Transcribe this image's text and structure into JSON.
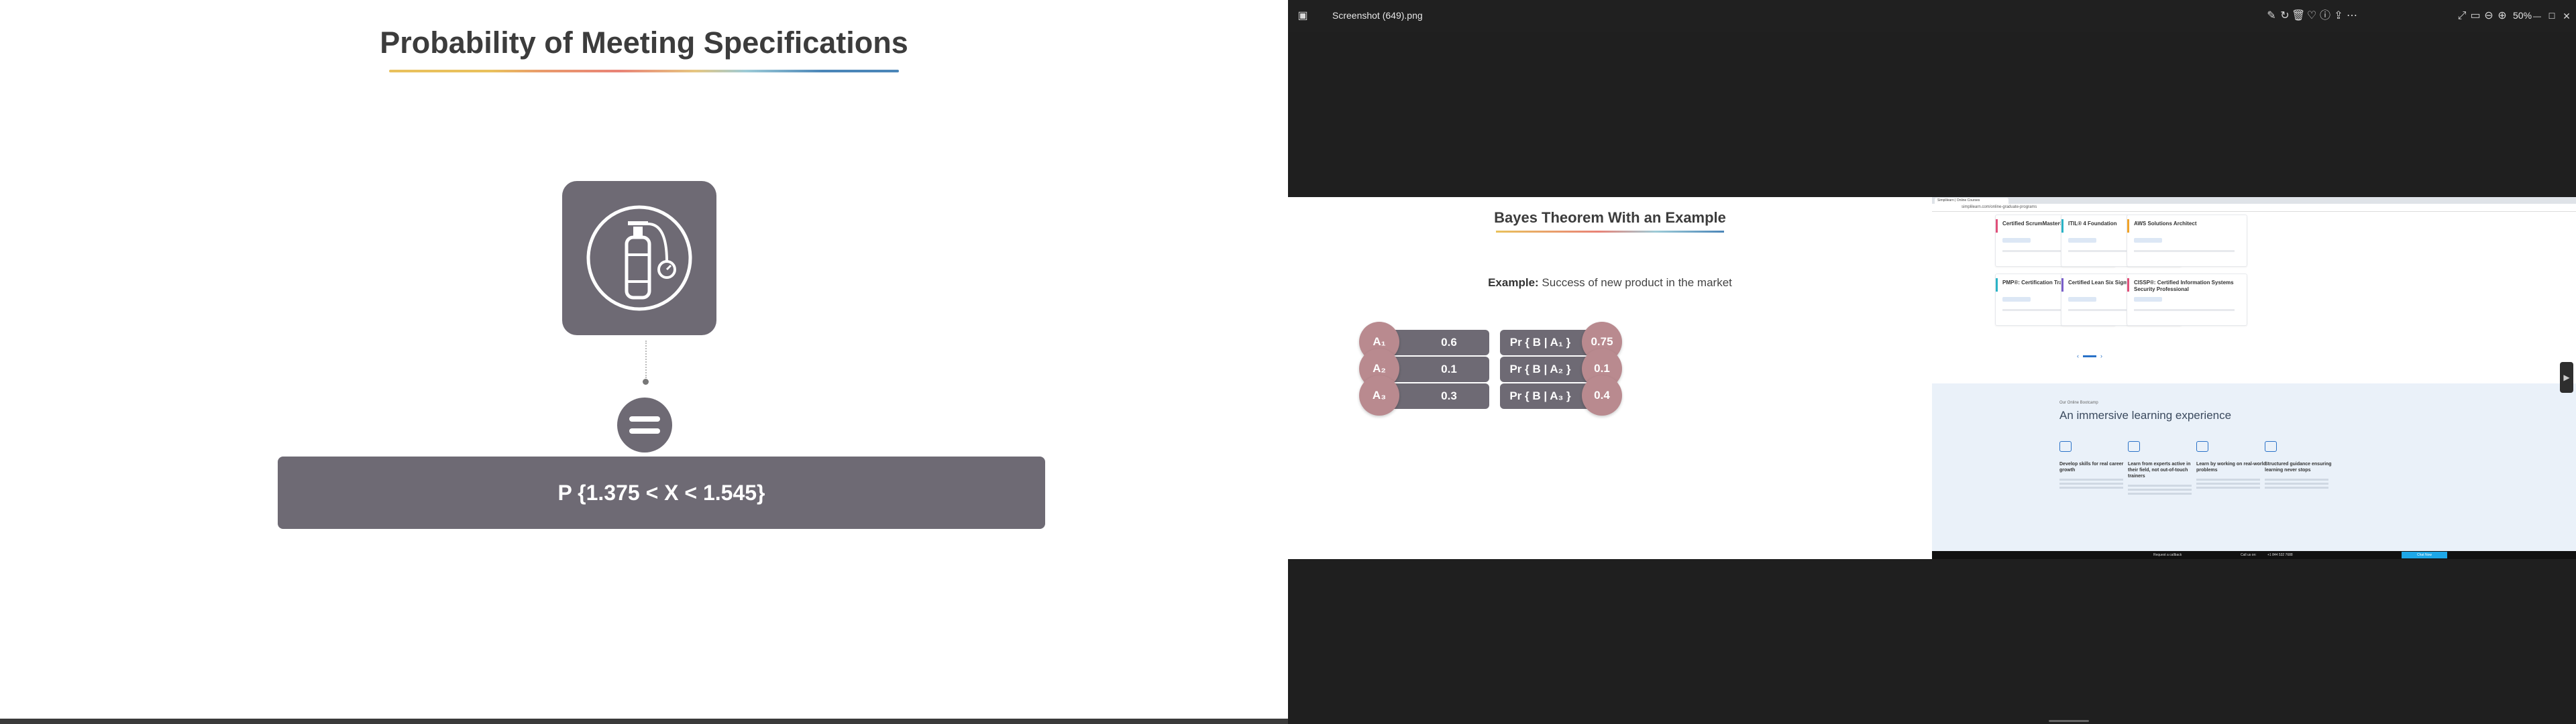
{
  "slide": {
    "title": "Probability of Meeting Specifications",
    "formula": "P {1.375 < X < 1.545}",
    "icon": "gas-cylinder-icon"
  },
  "viewer": {
    "file_name": "Screenshot (649).png",
    "zoom": "50%",
    "icons": [
      "edit-image-icon",
      "rotate-icon",
      "delete-icon",
      "favorite-icon",
      "info-icon",
      "share-icon",
      "more-icon",
      "fullscreen-icon",
      "slideshow-icon",
      "zoom-out-icon",
      "zoom-in-icon"
    ],
    "window_controls": [
      "minimize-icon",
      "maximize-icon",
      "close-icon"
    ]
  },
  "bayes": {
    "title": "Bayes Theorem With an Example",
    "example_label": "Example:",
    "example_text": " Success of new product in the market",
    "rows": [
      {
        "a": "A₁",
        "a_val": "0.6",
        "pr": "Pr { B | A₁ }",
        "pr_val": "0.75"
      },
      {
        "a": "A₂",
        "a_val": "0.1",
        "pr": "Pr { B | A₂ }",
        "pr_val": "0.1"
      },
      {
        "a": "A₃",
        "a_val": "0.3",
        "pr": "Pr { B | A₃ }",
        "pr_val": "0.4"
      }
    ]
  },
  "web": {
    "tab_title": "Simplilearn | Online Courses",
    "url": "simplilearn.com/online-graduate-programs",
    "cards": [
      {
        "title": "Certified ScrumMaster® (CSM)",
        "color": "#e0507a"
      },
      {
        "title": "ITIL® 4 Foundation",
        "color": "#2bb3c6"
      },
      {
        "title": "AWS Solutions Architect",
        "color": "#f0a32a"
      },
      {
        "title": "PMP®: Certification Training",
        "color": "#2bb3c6"
      },
      {
        "title": "Certified Lean Six Sigma Green Belt",
        "color": "#7a5fc9"
      },
      {
        "title": "CISSP®: Certified Information Systems Security Professional",
        "color": "#e0507a"
      }
    ],
    "kicker": "Our Online Bootcamp",
    "headline": "An immersive learning experience",
    "features": [
      "Develop skills for real career growth",
      "Learn from experts active in their field, not out-of-touch trainers",
      "Learn by working on real-world problems",
      "Structured guidance ensuring learning never stops"
    ],
    "footer": {
      "callback": "Request a callback",
      "call_us": "Call us on:",
      "phone": "+1 844 532 7688",
      "chat": "Chat Now"
    }
  }
}
